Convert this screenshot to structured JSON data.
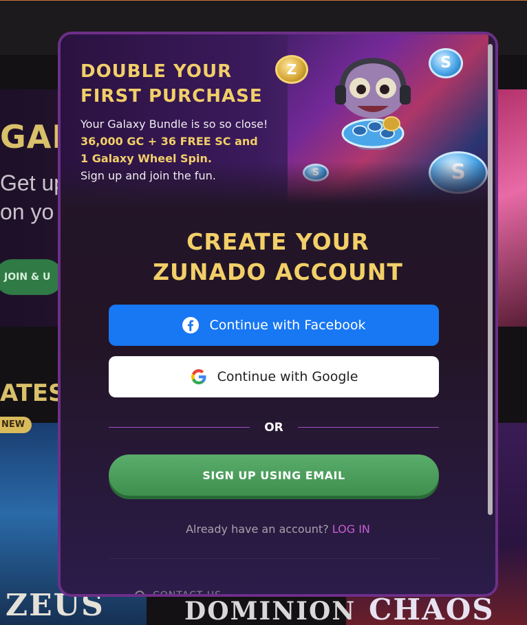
{
  "background": {
    "hero_title": "GAL",
    "hero_subtitle": "Get up on yo",
    "join_button": "JOIN & U",
    "latest_title": "ATEST",
    "new_badge": "NEW",
    "games": [
      "ZEUS",
      "DOMINION",
      "CHAOS"
    ]
  },
  "promo": {
    "title": "DOUBLE YOUR FIRST PURCHASE",
    "line1": "Your Galaxy Bundle is so so close!",
    "highlight1": "36,000 GC + 36 FREE SC and",
    "highlight2": "1 Galaxy Wheel Spin.",
    "line2": "Sign up and join the fun."
  },
  "signup": {
    "heading_line1": "CREATE YOUR",
    "heading_line2": "ZUNADO ACCOUNT",
    "facebook_label": "Continue with Facebook",
    "google_label": "Continue with Google",
    "or_label": "OR",
    "email_label": "SIGN UP USING EMAIL",
    "login_prompt": "Already have an account?",
    "login_link": "LOG IN",
    "contact_label": "CONTACT US"
  },
  "icons": {
    "facebook": "facebook-icon",
    "google": "google-icon",
    "contact": "chat-icon"
  },
  "colors": {
    "accent_gold": "#f2cf68",
    "facebook_blue": "#1877f2",
    "email_green": "#4c9d5c",
    "link_pink": "#c85fd3",
    "modal_border": "#6d2f88"
  }
}
